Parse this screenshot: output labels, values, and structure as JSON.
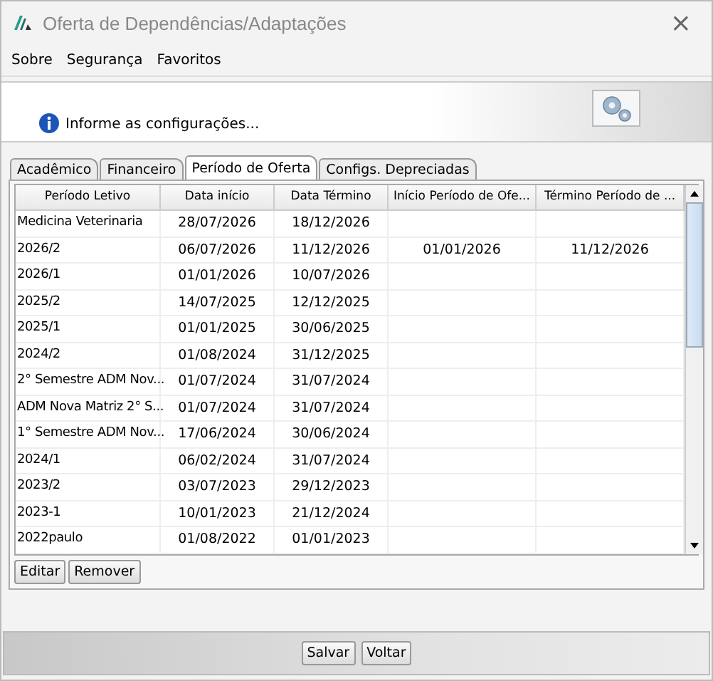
{
  "window": {
    "title": "Oferta de Dependências/Adaptações",
    "close": "×"
  },
  "menu": [
    "Sobre",
    "Segurança",
    "Favoritos"
  ],
  "banner": {
    "message": "Informe as configurações..."
  },
  "tabs": [
    {
      "label": "Acadêmico",
      "selected": false
    },
    {
      "label": "Financeiro",
      "selected": false
    },
    {
      "label": "Período de Oferta",
      "selected": true
    },
    {
      "label": "Configs. Depreciadas",
      "selected": false
    }
  ],
  "table": {
    "columns": [
      "Período Letivo",
      "Data início",
      "Data Término",
      "Início Período de Ofe...",
      "Término Período de ..."
    ],
    "rows": [
      [
        "Medicina Veterinaria",
        "28/07/2026",
        "18/12/2026",
        "",
        ""
      ],
      [
        "2026/2",
        "06/07/2026",
        "11/12/2026",
        "01/01/2026",
        "11/12/2026"
      ],
      [
        "2026/1",
        "01/01/2026",
        "10/07/2026",
        "",
        ""
      ],
      [
        "2025/2",
        "14/07/2025",
        "12/12/2025",
        "",
        ""
      ],
      [
        "2025/1",
        "01/01/2025",
        "30/06/2025",
        "",
        ""
      ],
      [
        "2024/2",
        "01/08/2024",
        "31/12/2025",
        "",
        ""
      ],
      [
        "2° Semestre ADM Nov...",
        "01/07/2024",
        "31/07/2024",
        "",
        ""
      ],
      [
        "ADM Nova Matriz 2° S...",
        "01/07/2024",
        "31/07/2024",
        "",
        ""
      ],
      [
        "1° Semestre ADM Nov...",
        "17/06/2024",
        "30/06/2024",
        "",
        ""
      ],
      [
        "2024/1",
        "06/02/2024",
        "31/07/2024",
        "",
        ""
      ],
      [
        "2023/2",
        "03/07/2023",
        "29/12/2023",
        "",
        ""
      ],
      [
        "2023-1",
        "10/01/2023",
        "21/12/2024",
        "",
        ""
      ],
      [
        "2022paulo",
        "01/08/2022",
        "01/01/2023",
        "",
        ""
      ]
    ]
  },
  "table_buttons": [
    "Editar",
    "Remover"
  ],
  "footer_buttons": [
    "Salvar",
    "Voltar"
  ]
}
